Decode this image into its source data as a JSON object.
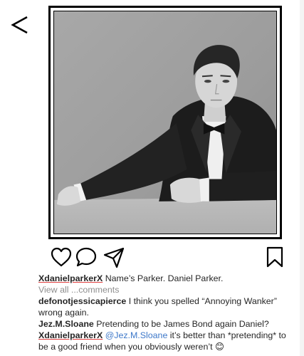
{
  "post": {
    "caption_user": "XdanielparkerX",
    "caption_text": "Name’s Parker. Daniel Parker.",
    "view_all": "View all ...comments"
  },
  "comments": [
    {
      "user": "defonotjessicapierce",
      "text": "I think you spelled “Annoying Wanker” wrong again."
    },
    {
      "user": "Jez.M.Sloane",
      "text": "Pretending to be James Bond again Daniel?"
    },
    {
      "user": "XdanielparkerX",
      "mention": "@Jez.M.Sloane",
      "text": "it’s better than *pretending* to be a good friend when you obviously weren’t",
      "emoji": "😊"
    }
  ],
  "icons": {
    "back": "chevron-left-icon",
    "like": "heart-icon",
    "comment": "comment-bubble-icon",
    "share": "send-icon",
    "save": "bookmark-icon"
  }
}
